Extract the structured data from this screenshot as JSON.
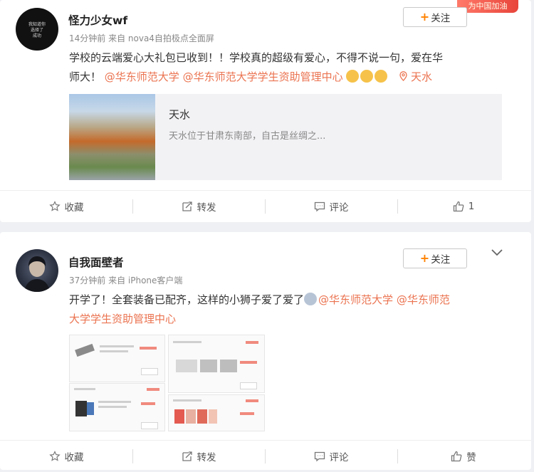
{
  "posts": [
    {
      "user": {
        "name": "怪力少女wf",
        "avatar_text": [
          "我知道你",
          "选择了",
          "成功"
        ]
      },
      "meta": "14分钟前 来自 nova4自拍极点全面屏",
      "follow_label": "关注",
      "corner_badge": "为中国加油",
      "text": {
        "line1": "学校的云端爱心大礼包已收到！！学校真的超级有爱心，不得不说一句，爱在华",
        "line2_plain": "师大！",
        "mention1": "@华东师范大学",
        "mention2": "@华东师范大学学生资助管理中心",
        "location": "天水"
      },
      "link_card": {
        "title": "天水",
        "desc": "天水位于甘肃东南部，自古是丝绸之..."
      },
      "actions": {
        "favorite": "收藏",
        "repost": "转发",
        "comment": "评论",
        "like": "1"
      }
    },
    {
      "user": {
        "name": "自我面壁者"
      },
      "meta": "37分钟前 来自 iPhone客户端",
      "follow_label": "关注",
      "text": {
        "line1_plain": "开学了！全套装备已配齐，这样的小狮子爱了爱了",
        "mention1": "@华东师范大学",
        "mention2a": "@华东师范",
        "mention2b": "大学学生资助管理中心"
      },
      "actions": {
        "favorite": "收藏",
        "repost": "转发",
        "comment": "评论",
        "like": "赞"
      }
    }
  ],
  "icons": [
    "star-icon",
    "repost-icon",
    "comment-icon",
    "thumbs-up-icon",
    "location-pin-icon",
    "chevron-down-icon",
    "plus-icon"
  ],
  "colors": {
    "mention": "#eb7350",
    "follow_plus": "#ff8200",
    "background": "#eef0f3"
  }
}
